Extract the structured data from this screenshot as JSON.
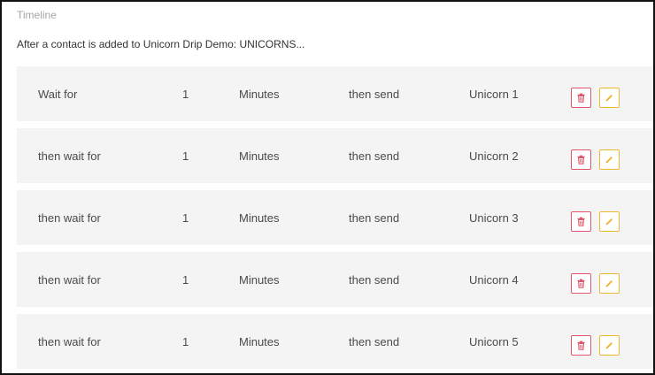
{
  "timeline": {
    "label": "Timeline",
    "intro": "After a contact is added to Unicorn Drip Demo: UNICORNS..."
  },
  "steps": [
    {
      "lead": "Wait for",
      "amount": "1",
      "unit": "Minutes",
      "action": "then send",
      "email": "Unicorn 1"
    },
    {
      "lead": "then wait for",
      "amount": "1",
      "unit": "Minutes",
      "action": "then send",
      "email": "Unicorn 2"
    },
    {
      "lead": "then wait for",
      "amount": "1",
      "unit": "Minutes",
      "action": "then send",
      "email": "Unicorn 3"
    },
    {
      "lead": "then wait for",
      "amount": "1",
      "unit": "Minutes",
      "action": "then send",
      "email": "Unicorn 4"
    },
    {
      "lead": "then wait for",
      "amount": "1",
      "unit": "Minutes",
      "action": "then send",
      "email": "Unicorn 5"
    }
  ],
  "actions": {
    "delete_icon": "trash-icon",
    "edit_icon": "pencil-icon"
  },
  "colors": {
    "delete": "#e0566a",
    "edit": "#efb834",
    "row_bg": "#f4f4f4"
  }
}
